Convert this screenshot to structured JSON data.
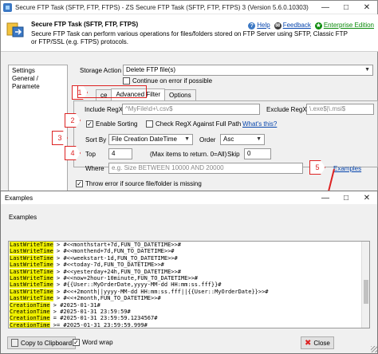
{
  "back_window": {
    "title": "Secure FTP Task (SFTP, FTP, FTPS) - ZS Secure FTP Task (SFTP, FTP, FTPS) 3 (Version 5.6.0.10303)",
    "header_title": "Secure FTP Task (SFTP, FTP, FTPS)",
    "header_desc": "Secure FTP Task can perform various operations for files/folders stored on FTP Server using SFTP, Classic FTP or FTP/SSL (e.g. FTPS) protocols.",
    "help_label": "Help",
    "feedback_label": "Feedback",
    "enterprise_label": "Enterprise Edition",
    "nav_items": [
      "Settings",
      "General / Paramete"
    ],
    "storage_action_label": "Storage Action",
    "storage_action_value": "Delete FTP file(s)",
    "continue_on_error_label": "Continue on error if possible",
    "tabs": [
      "Source",
      "Advanced Filter",
      "Options"
    ],
    "tab_source_short": "ce",
    "include_regex_label": "Include RegX",
    "include_regex_placeholder": "^MyFile\\d+\\.csv$",
    "exclude_regex_label": "Exclude RegX",
    "exclude_regex_placeholder": "\\.exe$|\\.msi$",
    "enable_sorting_label": "Enable Sorting",
    "check_regex_label": "Check RegX Against Full Path",
    "whats_this_label": "What's this?",
    "sort_by_label": "Sort By",
    "sort_by_value": "File Creation DateTime",
    "order_label": "Order",
    "order_value": "Asc",
    "top_label": "Top",
    "top_value": "4",
    "max_items_label": "(Max items to return. 0=All)",
    "skip_label": "Skip",
    "skip_value": "0",
    "where_label": "Where",
    "where_placeholder": "e.g. Size BETWEEN 10000 AND 20000",
    "examples_link": "Examples",
    "throw_error_label": "Throw error if source file/folder is missing",
    "markers": [
      "1",
      "2",
      "3",
      "4",
      "5"
    ]
  },
  "examples_window": {
    "title": "Examples",
    "subtitle": "Examples",
    "code_lines": [
      {
        "kw": "LastWriteTime",
        "rest": " > #<<monthstart+7d,FUN_TO_DATETIME>>#"
      },
      {
        "kw": "LastWriteTime",
        "rest": " > #<<monthend+7d,FUN_TO_DATETIME>>#"
      },
      {
        "kw": "LastWriteTime",
        "rest": " > #<<weekstart-1d,FUN_TO_DATETIME>>#"
      },
      {
        "kw": "LastWriteTime",
        "rest": " > #<<today-7d,FUN_TO_DATETIME>>#"
      },
      {
        "kw": "LastWriteTime",
        "rest": " > #<<yesterday+24h,FUN_TO_DATETIME>>#"
      },
      {
        "kw": "LastWriteTime",
        "rest": " > #<<now+2hour-10minute,FUN_TO_DATETIME>>#"
      },
      {
        "kw": "LastWriteTime",
        "rest": " > #{{User::MyOrderDate,yyyy-MM-dd HH:mm:ss.fff}}#"
      },
      {
        "kw": "LastWriteTime",
        "rest": " > #<<+2month||yyyy-MM-dd HH:mm:ss.fff||{{User::MyOrderDate}}>>#"
      },
      {
        "kw": "LastWriteTime",
        "rest": " > #<<+2month,FUN_TO_DATETIME>>#"
      },
      {
        "kw": "CreationTime",
        "rest": " > #2025-01-31#"
      },
      {
        "kw": "CreationTime",
        "rest": " > #2025-01-31 23:59:59#"
      },
      {
        "kw": "CreationTime",
        "rest": " = #2025-01-31 23:59:59.1234567#"
      },
      {
        "kw": "CreationTime",
        "rest": " >= #2025-01-31 23:59:59.999#"
      },
      {
        "kw": "CreationTime",
        "rest": " >= #2025-01-31# AND CreationTime <= #2025-02-28#"
      }
    ],
    "copy_button": "Copy to Clipboard",
    "word_wrap_label": "Word wrap",
    "close_button": "Close"
  },
  "colors": {
    "accent_red": "#dd2222",
    "highlight_yellow": "#f0f000",
    "link_blue": "#0645ad"
  }
}
